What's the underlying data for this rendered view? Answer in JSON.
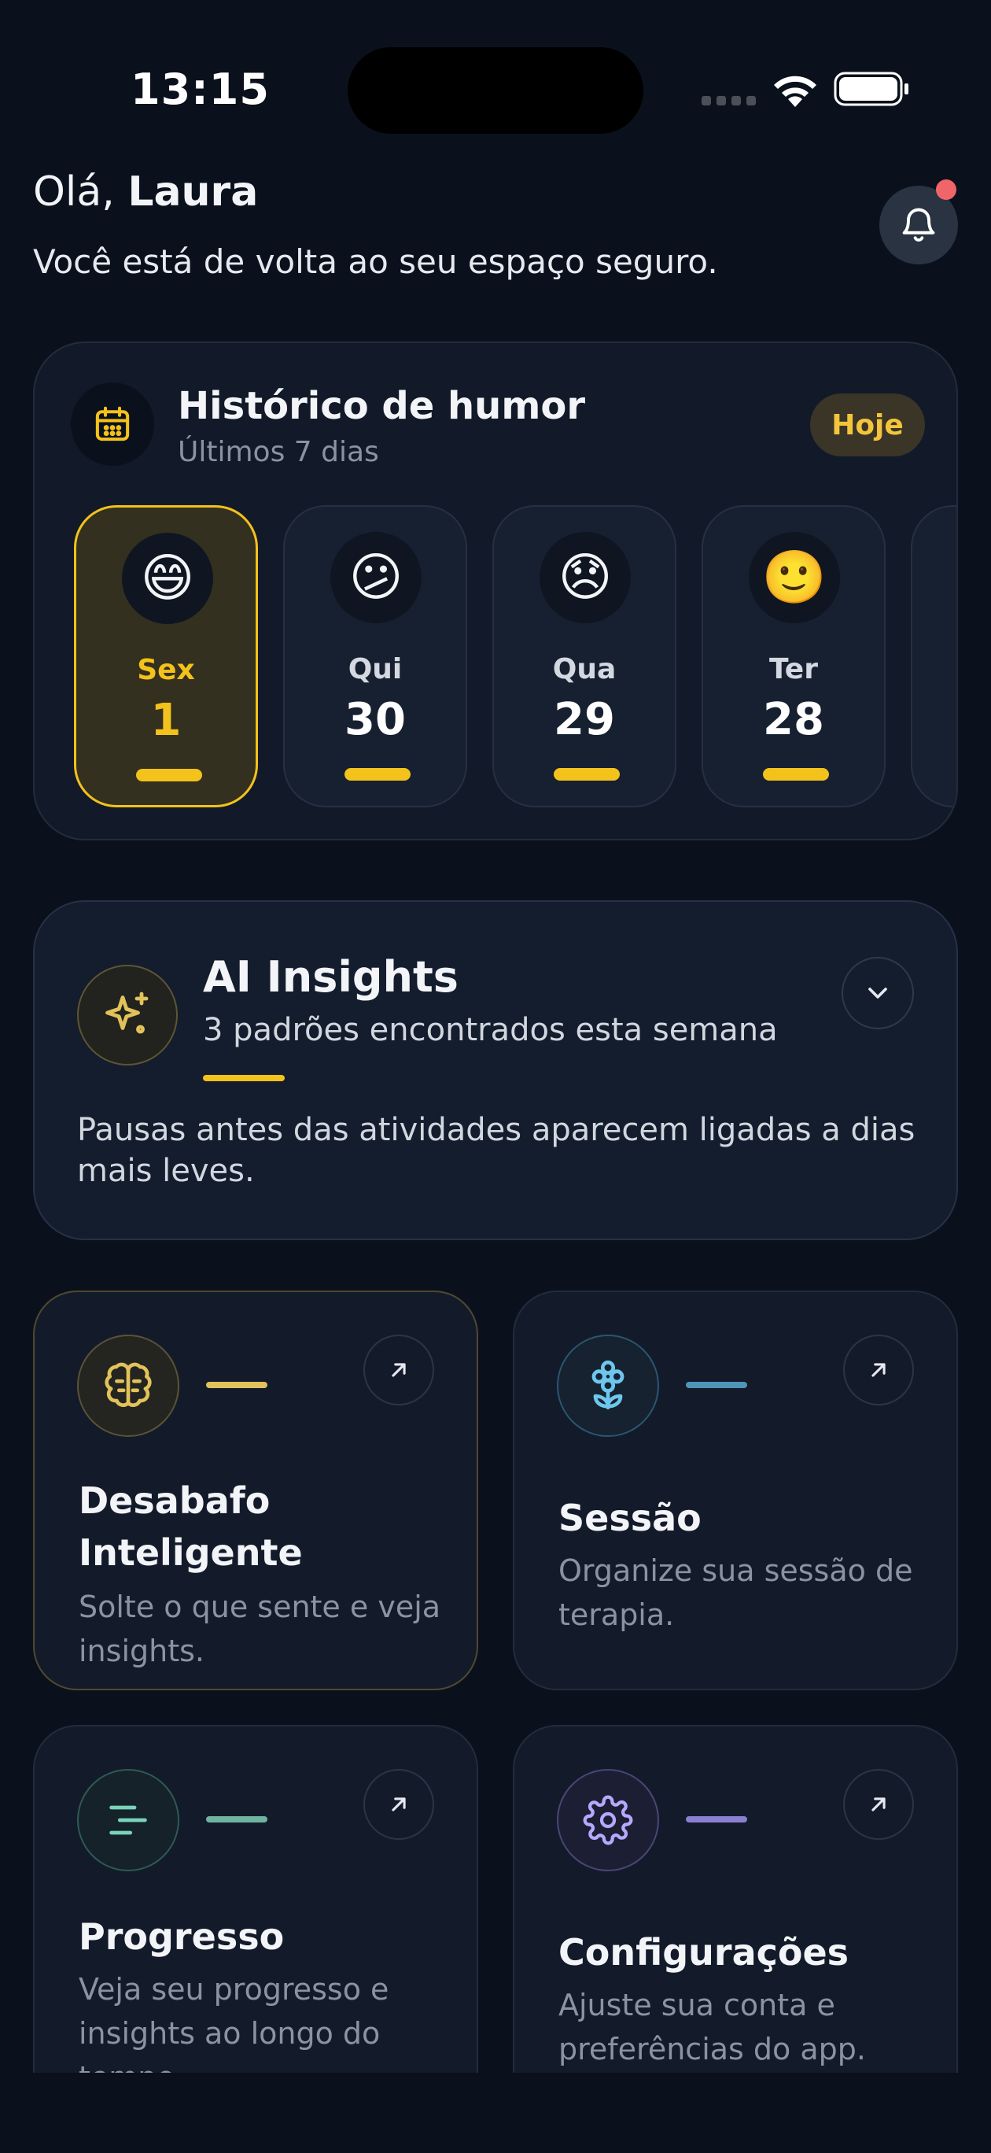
{
  "status_bar": {
    "time": "13:15"
  },
  "greeting": {
    "hello": "Olá,",
    "name": "Laura",
    "subtitle": "Você está de volta ao seu espaço seguro."
  },
  "mood_history": {
    "title": "Histórico de humor",
    "subtitle": "Últimos 7 dias",
    "today_label": "Hoje",
    "days": [
      {
        "emoji": "😄",
        "day": "Sex",
        "date": "1"
      },
      {
        "emoji": "😕",
        "day": "Qui",
        "date": "30"
      },
      {
        "emoji": "😞",
        "day": "Qua",
        "date": "29"
      },
      {
        "emoji": "🙂",
        "day": "Ter",
        "date": "28"
      }
    ]
  },
  "ai_insights": {
    "title": "AI Insights",
    "subtitle": "3 padrões encontrados esta semana",
    "body": "Pausas antes das atividades aparecem ligadas a dias mais leves."
  },
  "features": [
    {
      "title": "Desabafo Inteligente",
      "description": "Solte o que sente e veja insights.",
      "icon": "brain-icon",
      "accent": "#e2c25a"
    },
    {
      "title": "Sessão",
      "description": "Organize sua sessão de terapia.",
      "icon": "flower-icon",
      "accent": "#4f95b8"
    },
    {
      "title": "Progresso",
      "description": "Veja seu progresso e insights ao longo do tempo.",
      "icon": "progress-lines-icon",
      "accent": "#6fb3a0"
    },
    {
      "title": "Configurações",
      "description": "Ajuste sua conta e preferências do app.",
      "icon": "gear-icon",
      "accent": "#8a7fd0"
    }
  ],
  "colors": {
    "accent_yellow": "#f3c21b",
    "background": "#0b111c",
    "card": "#121a29",
    "notification_dot": "#f0656a"
  }
}
